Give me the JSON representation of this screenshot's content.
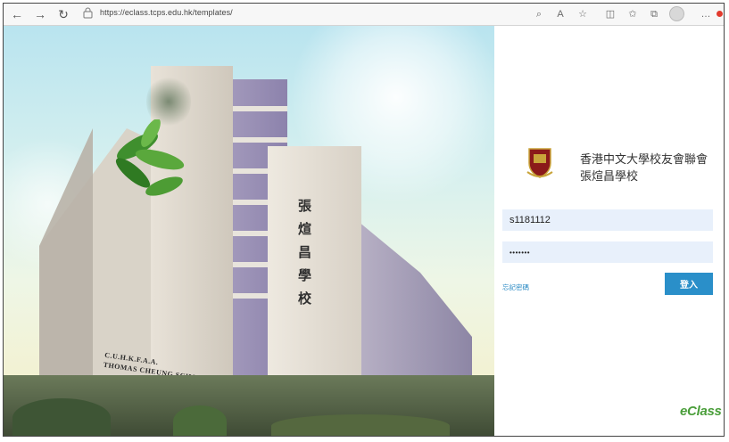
{
  "browser": {
    "url": "https://eclass.tcps.edu.hk/templates/",
    "icons": [
      "back-arrow-icon",
      "forward-arrow-icon",
      "refresh-icon",
      "lock-icon",
      "read-aloud-icon",
      "text-size-icon",
      "favorite-star-icon",
      "split-screen-icon",
      "favorites-icon",
      "collections-icon",
      "extensions-icon",
      "profile-avatar-icon",
      "more-icon"
    ]
  },
  "hero": {
    "building_sign_cn": "張煊昌學校",
    "building_sign_en_line1": "C.U.H.K.F.A.A.",
    "building_sign_en_line2": "THOMAS CHEUNG SCHOOL"
  },
  "login": {
    "school_name_line1": "香港中文大學校友會聯會",
    "school_name_line2": "張煊昌學校",
    "username_value": "s1181112",
    "password_value": "•••••••",
    "forgot_password": "忘記密碼",
    "login_button": "登入",
    "brand": "eClass"
  },
  "colors": {
    "accent": "#2a8fc9",
    "field_bg": "#e8f0fb",
    "brand_green": "#4a9e3a"
  }
}
